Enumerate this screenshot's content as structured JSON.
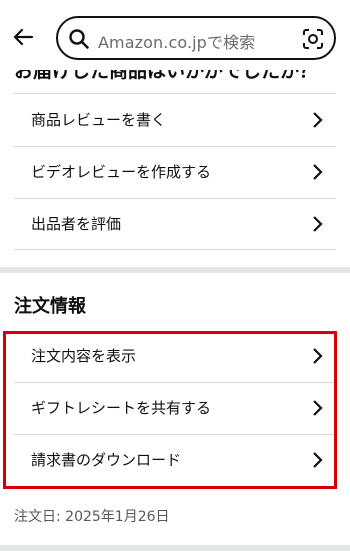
{
  "header": {
    "search_placeholder": "Amazon.co.jpで検索"
  },
  "review_section": {
    "title": "お届けした商品はいかがでしたか？",
    "items": [
      {
        "label": "商品レビューを書く"
      },
      {
        "label": "ビデオレビューを作成する"
      },
      {
        "label": "出品者を評価"
      }
    ]
  },
  "order_section": {
    "title": "注文情報",
    "items": [
      {
        "label": "注文内容を表示"
      },
      {
        "label": "ギフトレシートを共有する"
      },
      {
        "label": "請求書のダウンロード"
      }
    ],
    "order_date": "注文日: 2025年1月26日"
  },
  "colors": {
    "highlight": "#d60000",
    "divider": "#d5d9d9",
    "section_separator": "#e3e6e6"
  },
  "icons": [
    "back-arrow-icon",
    "search-icon",
    "camera-lens-icon",
    "chevron-right-icon"
  ]
}
